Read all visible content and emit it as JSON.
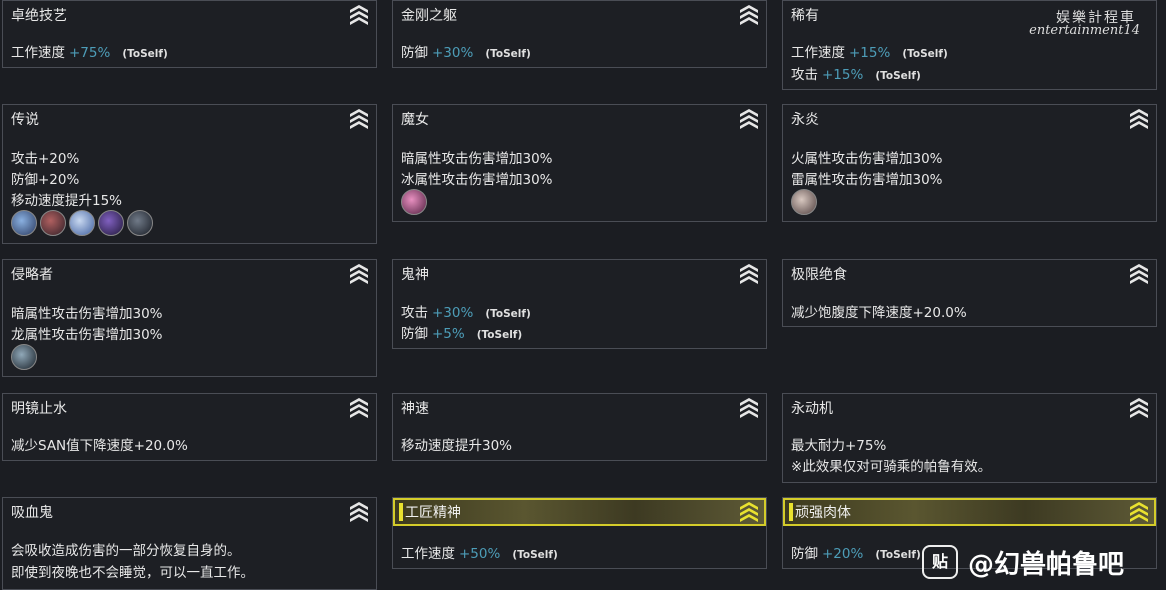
{
  "cards": {
    "c1": {
      "title": "卓绝技艺",
      "l1": "工作速度",
      "v1": "+75%",
      "t1": "(ToSelf)"
    },
    "c2": {
      "title": "金刚之躯",
      "l1": "防御",
      "v1": "+30%",
      "t1": "(ToSelf)"
    },
    "c3": {
      "title": "稀有",
      "l1": "工作速度",
      "v1": "+15%",
      "t1": "(ToSelf)",
      "l2": "攻击",
      "v2": "+15%",
      "t2": "(ToSelf)"
    },
    "c4": {
      "title": "传说",
      "l1": "攻击+20%",
      "l2": "防御+20%",
      "l3": "移动速度提升15%"
    },
    "c5": {
      "title": "魔女",
      "l1": "暗属性攻击伤害增加30%",
      "l2": "冰属性攻击伤害增加30%"
    },
    "c6": {
      "title": "永炎",
      "l1": "火属性攻击伤害增加30%",
      "l2": "雷属性攻击伤害增加30%"
    },
    "c7": {
      "title": "侵略者",
      "l1": "暗属性攻击伤害增加30%",
      "l2": "龙属性攻击伤害增加30%"
    },
    "c8": {
      "title": "鬼神",
      "l1": "攻击",
      "v1": "+30%",
      "t1": "(ToSelf)",
      "l2": "防御",
      "v2": "+5%",
      "t2": "(ToSelf)"
    },
    "c9": {
      "title": "极限绝食",
      "l1": "减少饱腹度下降速度+20.0%"
    },
    "c10": {
      "title": "明镜止水",
      "l1": "减少SAN值下降速度+20.0%"
    },
    "c11": {
      "title": "神速",
      "l1": "移动速度提升30%"
    },
    "c12": {
      "title": "永动机",
      "l1": "最大耐力+75%",
      "l2": "※此效果仅对可骑乘的帕鲁有效。"
    },
    "c13": {
      "title": "吸血鬼",
      "l1": "会吸收造成伤害的一部分恢复自身的。",
      "l2": "即使到夜晚也不会睡觉，可以一直工作。"
    },
    "c14": {
      "title": "工匠精神",
      "l1": "工作速度",
      "v1": "+50%",
      "t1": "(ToSelf)"
    },
    "c15": {
      "title": "顽强肉体",
      "l1": "防御",
      "v1": "+20%",
      "t1": "(ToSelf)"
    }
  },
  "watermark": {
    "line1": "娱樂計程車",
    "line2": "entertainment14"
  },
  "tieba": {
    "logo": "贴",
    "text": "@幻兽帕鲁吧"
  },
  "icons": {
    "chevron": "rank-chevron-icon",
    "pal": "pal-portrait-icon"
  },
  "colors": {
    "value": "#4d9db8",
    "gold": "#d4cc2a",
    "border": "#4a4d55"
  }
}
